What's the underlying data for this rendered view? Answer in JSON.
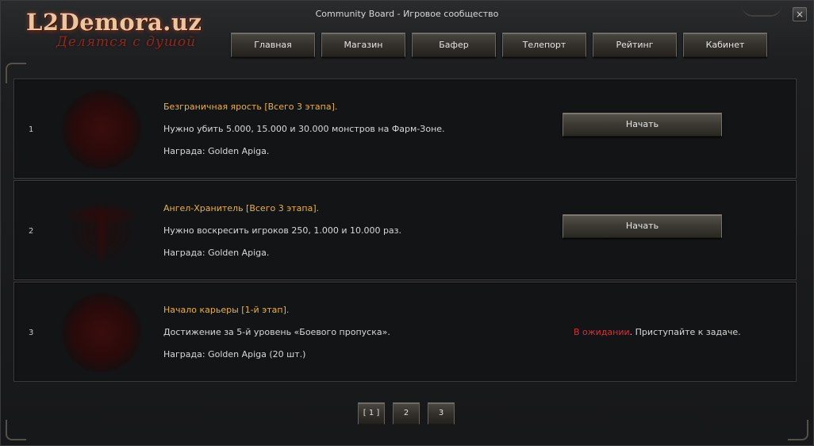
{
  "window": {
    "title": "Community Board - Игровое сообщество",
    "close_glyph": "×"
  },
  "logo": {
    "main": "L2Demora.uz",
    "tagline": "Делятся с душой"
  },
  "nav": [
    "Главная",
    "Магазин",
    "Бафер",
    "Телепорт",
    "Рейтинг",
    "Кабинет"
  ],
  "rows": [
    {
      "num": "1",
      "icon": "dark-rose-icon",
      "title": "Безграничная ярость [Всего 3 этапа].",
      "desc": "Нужно убить 5.000, 15.000 и 30.000 монстров на Фарм-Зоне.",
      "reward": "Награда: Golden Apiga.",
      "action": "Начать"
    },
    {
      "num": "2",
      "icon": "caduceus-icon",
      "title": "Ангел-Хранитель [Всего 3 этапа].",
      "desc": "Нужно воскресить игроков 250, 1.000 и 10.000 раз.",
      "reward": "Награда: Golden Apiga.",
      "action": "Начать"
    },
    {
      "num": "3",
      "icon": "heart-emblem-icon",
      "title": "Начало карьеры [1-й этап].",
      "desc": "Достижение за 5-й уровень «Боевого пропуска».",
      "reward": "Награда: Golden Apiga (20 шт.)",
      "status_pending": "В ожидании",
      "status_text": ".  Приступайте к задаче."
    }
  ],
  "pager": [
    "[ 1 ]",
    "2",
    "3"
  ],
  "colors": {
    "title_gold": "#e8b04a",
    "pending_red": "#d2323a",
    "row_bg": "#131416"
  }
}
